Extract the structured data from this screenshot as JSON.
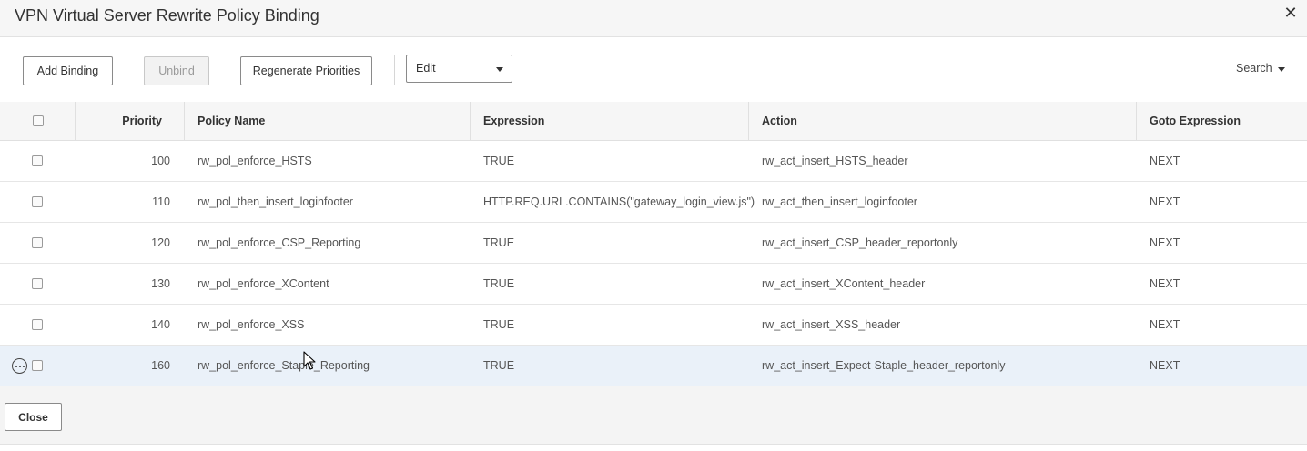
{
  "dialog": {
    "title": "VPN Virtual Server Rewrite Policy Binding",
    "close_icon": "close-icon"
  },
  "toolbar": {
    "add_binding_label": "Add Binding",
    "unbind_label": "Unbind",
    "regenerate_label": "Regenerate Priorities",
    "action_select_value": "Edit",
    "search_label": "Search"
  },
  "table": {
    "columns": [
      "Priority",
      "Policy Name",
      "Expression",
      "Action",
      "Goto Expression"
    ],
    "rows": [
      {
        "priority": "100",
        "policy": "rw_pol_enforce_HSTS",
        "expression": "TRUE",
        "action": "rw_act_insert_HSTS_header",
        "goto": "NEXT"
      },
      {
        "priority": "110",
        "policy": "rw_pol_then_insert_loginfooter",
        "expression": "HTTP.REQ.URL.CONTAINS(\"gateway_login_view.js\")",
        "action": "rw_act_then_insert_loginfooter",
        "goto": "NEXT"
      },
      {
        "priority": "120",
        "policy": "rw_pol_enforce_CSP_Reporting",
        "expression": "TRUE",
        "action": "rw_act_insert_CSP_header_reportonly",
        "goto": "NEXT"
      },
      {
        "priority": "130",
        "policy": "rw_pol_enforce_XContent",
        "expression": "TRUE",
        "action": "rw_act_insert_XContent_header",
        "goto": "NEXT"
      },
      {
        "priority": "140",
        "policy": "rw_pol_enforce_XSS",
        "expression": "TRUE",
        "action": "rw_act_insert_XSS_header",
        "goto": "NEXT"
      },
      {
        "priority": "160",
        "policy": "rw_pol_enforce_Staple_Reporting",
        "expression": "TRUE",
        "action": "rw_act_insert_Expect-Staple_header_reportonly",
        "goto": "NEXT"
      }
    ]
  },
  "footer": {
    "close_label": "Close"
  },
  "colors": {
    "highlight_row": "#eaf1f9",
    "header_bg": "#f6f6f6"
  }
}
